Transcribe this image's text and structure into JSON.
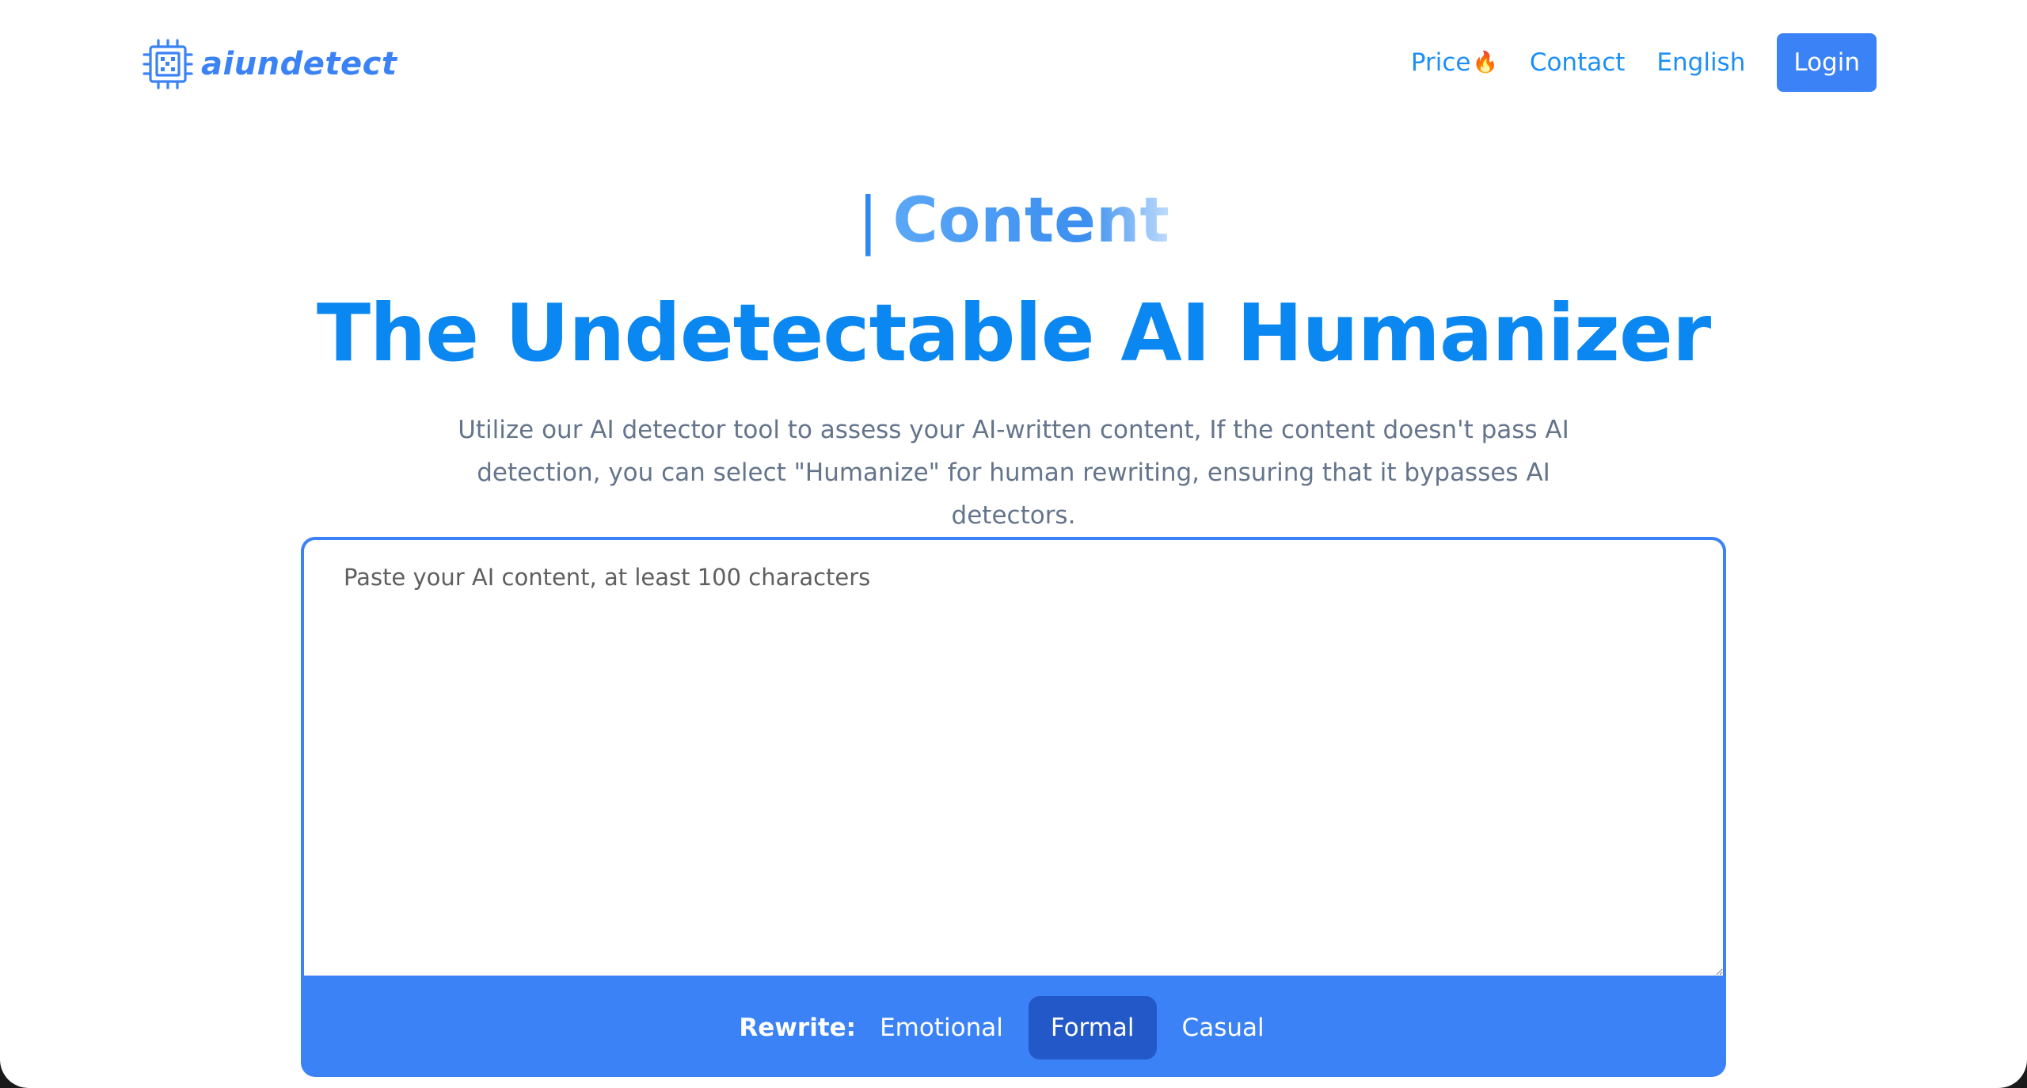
{
  "header": {
    "logo_text": "aiundetect",
    "logo_icon": "chip-icon",
    "nav": {
      "price_label": "Price",
      "price_emoji": "🔥",
      "contact_label": "Contact",
      "language_label": "English",
      "login_label": "Login"
    }
  },
  "hero": {
    "typing_caret": "|",
    "typing_word": "Content",
    "title": "The Undetectable AI Humanizer",
    "subtitle": "Utilize our AI detector tool to assess your AI-written content, If the content doesn't pass AI detection, you can select \"Humanize\" for human rewriting, ensuring that it bypasses AI detectors."
  },
  "editor": {
    "placeholder": "Paste your AI content, at least 100 characters",
    "value": "",
    "rewrite_label": "Rewrite:",
    "modes": [
      {
        "label": "Emotional",
        "active": false
      },
      {
        "label": "Formal",
        "active": true
      },
      {
        "label": "Casual",
        "active": false
      }
    ]
  },
  "colors": {
    "brand": "#3b82f6",
    "title": "#0a87f1",
    "active_mode": "#2358c9",
    "subtitle": "#64748b"
  }
}
